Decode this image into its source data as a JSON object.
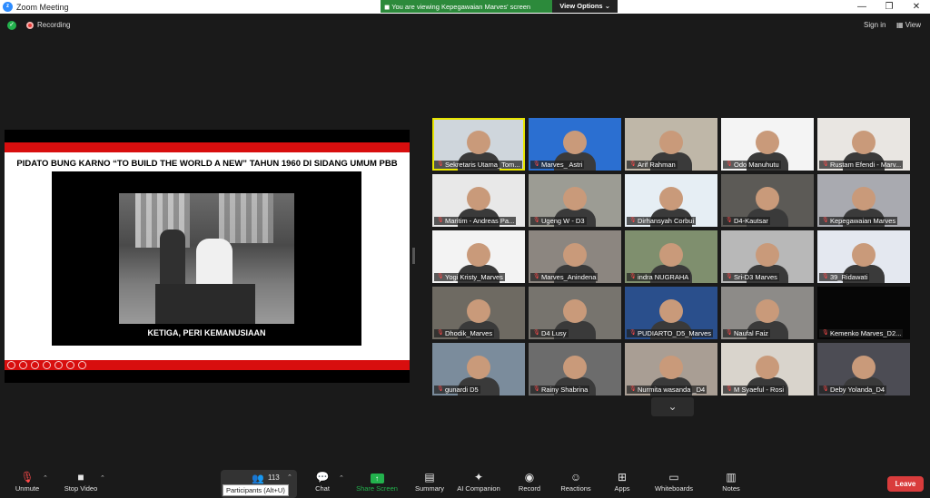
{
  "window": {
    "title": "Zoom Meeting",
    "min": "—",
    "max": "❐",
    "close": "✕"
  },
  "banner": {
    "message": "You are viewing Kepegawaian Marves' screen",
    "options": "View Options",
    "caret": "⌄"
  },
  "top": {
    "recording": "Recording",
    "sign_in": "Sign in",
    "view": "View"
  },
  "slide": {
    "title": "PIDATO BUNG KARNO “TO BUILD THE WORLD A NEW”  TAHUN 1960 DI SIDANG UMUM PBB",
    "caption": "KETIGA, PERI KEMANUSIAAN"
  },
  "participants_tiles": [
    {
      "name": "Sekretaris Utama_Tom...",
      "bg": "#cfd6dc"
    },
    {
      "name": "Marves_ Astri",
      "bg": "#2b6fd1"
    },
    {
      "name": "Arif Rahman",
      "bg": "#bfb7a8"
    },
    {
      "name": "Odo Manuhutu",
      "bg": "#f4f4f4"
    },
    {
      "name": "Rustam Efendi - Marv...",
      "bg": "#e9e6e2"
    },
    {
      "name": "Maritim - Andreas Pa...",
      "bg": "#e8e8e8"
    },
    {
      "name": "Ugeng W - D3",
      "bg": "#9c9c94"
    },
    {
      "name": "Dirhansyah Corbui",
      "bg": "#e6eef4"
    },
    {
      "name": "D4-Kautsar",
      "bg": "#5c5a56"
    },
    {
      "name": "Kepegawaian Marves",
      "bg": "#a9aab0"
    },
    {
      "name": "Yogi Kristy_Marves",
      "bg": "#f3f3f3"
    },
    {
      "name": "Marves_Anindena",
      "bg": "#8c8680"
    },
    {
      "name": "indra NUGRAHA",
      "bg": "#7f8f6e"
    },
    {
      "name": "Sri-D3 Marves",
      "bg": "#b8b8b8"
    },
    {
      "name": "39_Ridawati",
      "bg": "#e4e8f0"
    },
    {
      "name": "Dhodik_Marves",
      "bg": "#6e6a62"
    },
    {
      "name": "D4 Lusy",
      "bg": "#77746e"
    },
    {
      "name": "PUDIARTO_D5_Marves",
      "bg": "#2a4f8c"
    },
    {
      "name": "Naufal Faiz",
      "bg": "#8d8b88"
    },
    {
      "name": "Kemenko Marves_D2...",
      "bg": "#060606"
    },
    {
      "name": "gunardi D5",
      "bg": "#7b8c9c"
    },
    {
      "name": "Rainy Shabrina",
      "bg": "#6c6c6c"
    },
    {
      "name": "Nurmita wasanda _D4",
      "bg": "#a99e94"
    },
    {
      "name": "M Syaeful - Rosi",
      "bg": "#d9d4cc"
    },
    {
      "name": "Deby Yolanda_D4",
      "bg": "#4c4c54"
    }
  ],
  "toolbar": {
    "unmute": "Unmute",
    "stop_video": "Stop Video",
    "participants_count": "113",
    "participants_tip": "Participants (Alt+U)",
    "chat": "Chat",
    "share_screen": "Share Screen",
    "summary": "Summary",
    "ai_companion": "AI Companion",
    "record": "Record",
    "reactions": "Reactions",
    "apps": "Apps",
    "whiteboards": "Whiteboards",
    "notes": "Notes",
    "leave": "Leave"
  },
  "colors": {
    "active_speaker": "#e7e500",
    "share_green": "#23b14d",
    "leave_red": "#d93c3c",
    "slide_red": "#d80e0e"
  }
}
